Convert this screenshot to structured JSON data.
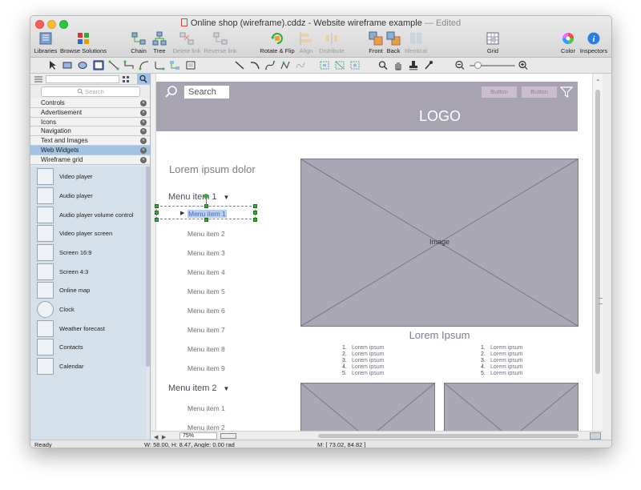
{
  "window": {
    "title": "Online shop (wireframe).cddz - Website wireframe example",
    "edited": "— Edited"
  },
  "toolbar": {
    "items": [
      {
        "label": "Libraries",
        "icon": "libraries-icon",
        "enabled": true
      },
      {
        "label": "Browse Solutions",
        "icon": "browse-solutions-icon",
        "enabled": true
      },
      {
        "label": "Chain",
        "icon": "chain-icon",
        "enabled": true
      },
      {
        "label": "Tree",
        "icon": "tree-icon",
        "enabled": true
      },
      {
        "label": "Delete link",
        "icon": "delete-link-icon",
        "enabled": false
      },
      {
        "label": "Reverse link",
        "icon": "reverse-link-icon",
        "enabled": false
      },
      {
        "label": "Rotate & Flip",
        "icon": "rotate-flip-icon",
        "enabled": true
      },
      {
        "label": "Align",
        "icon": "align-icon",
        "enabled": false
      },
      {
        "label": "Distribute",
        "icon": "distribute-icon",
        "enabled": false
      },
      {
        "label": "Front",
        "icon": "front-icon",
        "enabled": true
      },
      {
        "label": "Back",
        "icon": "back-icon",
        "enabled": true
      },
      {
        "label": "Identical",
        "icon": "identical-icon",
        "enabled": false
      },
      {
        "label": "Grid",
        "icon": "grid-icon",
        "enabled": true
      },
      {
        "label": "Color",
        "icon": "color-wheel-icon",
        "enabled": true
      },
      {
        "label": "Inspectors",
        "icon": "info-icon",
        "enabled": true
      }
    ]
  },
  "sidebar": {
    "search_placeholder": "Search",
    "categories": [
      {
        "label": "Controls",
        "selected": false
      },
      {
        "label": "Advertisement",
        "selected": false
      },
      {
        "label": "Icons",
        "selected": false
      },
      {
        "label": "Navigation",
        "selected": false
      },
      {
        "label": "Text and Images",
        "selected": false
      },
      {
        "label": "Web Widgets",
        "selected": true
      },
      {
        "label": "Wireframe grid",
        "selected": false
      }
    ],
    "library_items": [
      "Video player",
      "Audio player",
      "Audio player volume control",
      "Video player screen",
      "Screen 16:9",
      "Screen 4:3",
      "Online map",
      "Clock",
      "Weather forecast",
      "Contacts",
      "Calendar"
    ]
  },
  "wireframe": {
    "search_label": "Search",
    "button_labels": [
      "Button",
      "Button"
    ],
    "logo": "LOGO",
    "heading": "Lorem ipsum dolor",
    "menu1": "Menu item 1",
    "menu1_items": [
      "Menu item 1",
      "Menu item 2",
      "Menu item 3",
      "Menu item 4",
      "Menu item 5",
      "Menu item 6",
      "Menu item 7",
      "Menu item 8",
      "Menu item 9"
    ],
    "menu2": "Menu item 2",
    "menu2_items": [
      "Menu item 1",
      "Menu item 2"
    ],
    "image_label": "Image",
    "subtitle": "Lorem Ipsum",
    "list_left": [
      "Lorem ipsum",
      "Lorem ipsum",
      "Lorem ipsum",
      "Lorem ipsum",
      "Lorem ipsum"
    ],
    "list_right": [
      "Lorem ipsum",
      "Lorem ipsum",
      "Lorem ipsum",
      "Lorem ipsum",
      "Lorem ipsum"
    ],
    "list_numbers": [
      "1.",
      "2.",
      "3.",
      "4.",
      "5."
    ]
  },
  "zoom": "75%",
  "status": {
    "state": "Ready",
    "dimensions": "W: 58.00,  H: 8.47,  Angle: 0.00 rad",
    "mouse": "M: [ 73.02, 84.82 ]"
  }
}
